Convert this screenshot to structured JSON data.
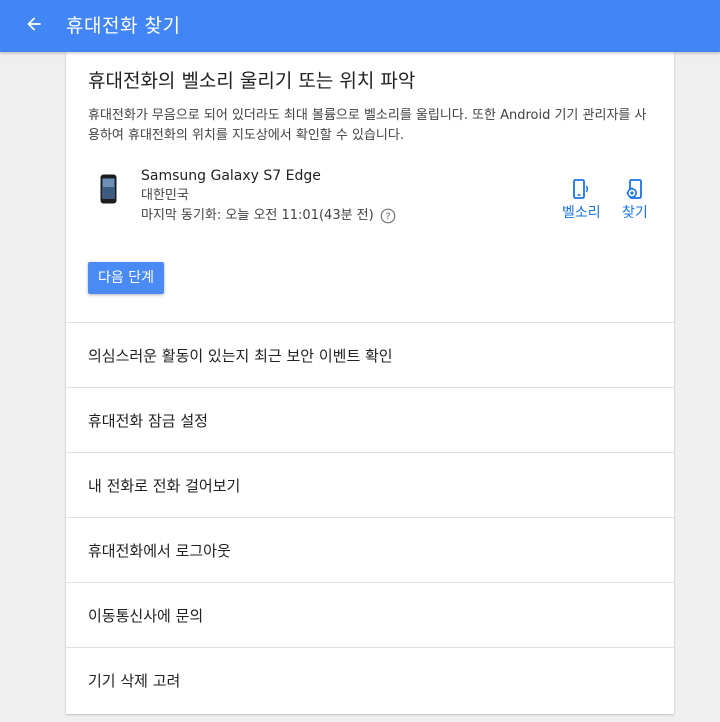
{
  "appbar": {
    "title": "휴대전화 찾기",
    "back_icon": "arrow-back-icon",
    "color": "#4285f4"
  },
  "ring_section": {
    "title": "휴대전화의 벨소리 울리기 또는 위치 파악",
    "description": "휴대전화가 무음으로 되어 있더라도 최대 볼륨으로 벨소리를 울립니다. 또한 Android 기기 관리자를 사용하여 휴대전화의 위치를 지도상에서 확인할 수 있습니다."
  },
  "device": {
    "icon": "smartphone-icon",
    "name": "Samsung Galaxy S7 Edge",
    "country": "대한민국",
    "last_sync": "마지막 동기화: 오늘 오전 11:01(43분 전)",
    "help_icon": "help-circle-icon"
  },
  "actions": {
    "ring_label": "벨소리",
    "ring_icon": "phone-ring-icon",
    "find_label": "찾기",
    "find_icon": "locate-phone-icon",
    "color": "#1a73e8"
  },
  "next_button": {
    "label": "다음 단계",
    "color": "#4a8af4"
  },
  "list_items": [
    {
      "label": "의심스러운 활동이 있는지 최근 보안 이벤트 확인"
    },
    {
      "label": "휴대전화 잠금 설정"
    },
    {
      "label": "내 전화로 전화 걸어보기"
    },
    {
      "label": "휴대전화에서 로그아웃"
    },
    {
      "label": "이동통신사에 문의"
    },
    {
      "label": "기기 삭제 고려"
    }
  ]
}
